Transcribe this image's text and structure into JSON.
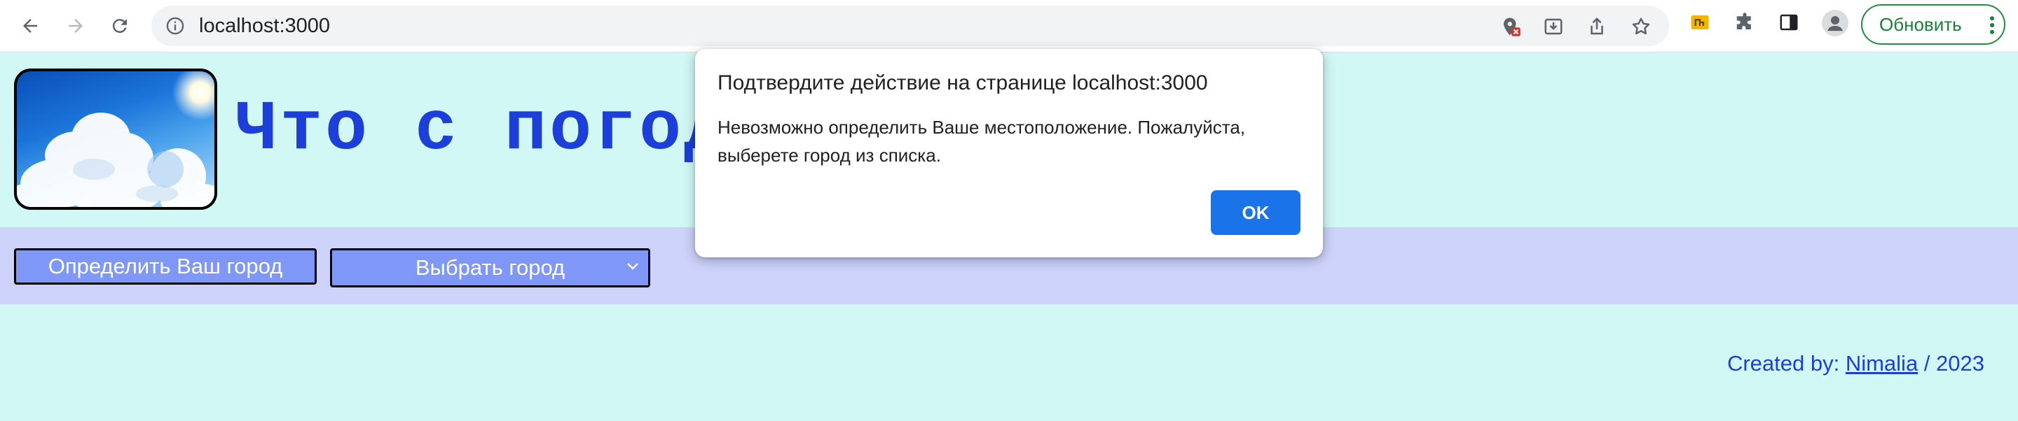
{
  "browser": {
    "url": "localhost:3000",
    "update_label": "Обновить"
  },
  "page": {
    "title": "Что с погод",
    "locate_button_label": "Определить Ваш город",
    "city_select_label": "Выбрать город",
    "footer": {
      "prefix": "Created by: ",
      "author": "Nimalia",
      "suffix": " / 2023"
    }
  },
  "dialog": {
    "title": "Подтвердите действие на странице localhost:3000",
    "message_line1": "Невозможно определить Ваше местоположение. Пожалуйста,",
    "message_line2": "выберете город из списка.",
    "ok_label": "OK"
  },
  "colors": {
    "page_bg": "#d2f8f6",
    "controls_bg": "#cdd3fa",
    "button_bg": "#7f97f6",
    "title_blue": "#1b3fd8",
    "dialog_ok": "#1a73e8",
    "update_green": "#188038"
  }
}
